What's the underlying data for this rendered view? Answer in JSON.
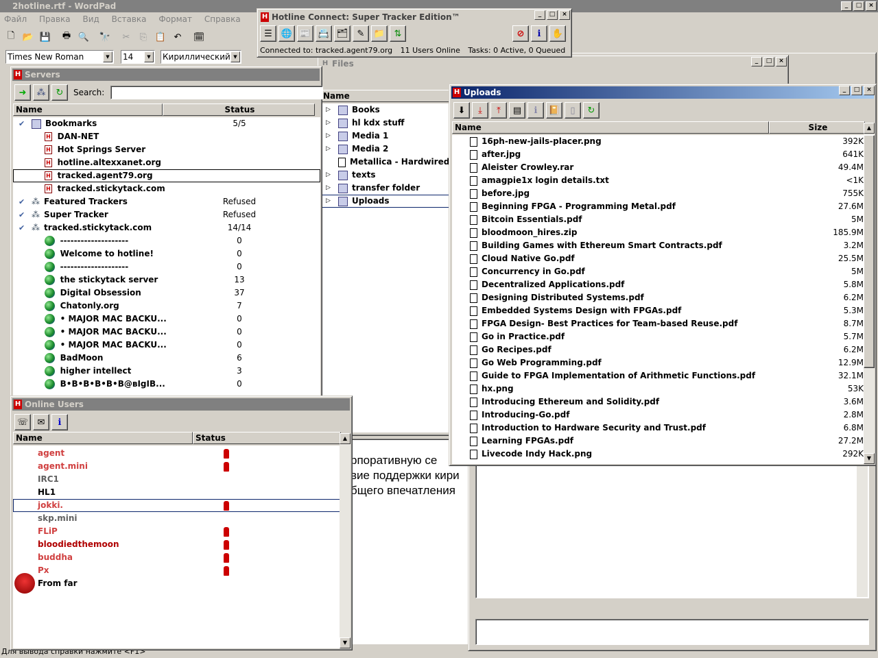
{
  "wordpad": {
    "title": "2hotline.rtf - WordPad",
    "menu": [
      "Файл",
      "Правка",
      "Вид",
      "Вставка",
      "Формат",
      "Справка"
    ],
    "font": "Times New Roman",
    "size": "14",
    "script": "Кириллический",
    "doc_lines": [
      "рпоративную се",
      "вие поддержки кири",
      "бщего впечатления"
    ],
    "status": "Для вывода справки нажмите <F1>"
  },
  "hotline": {
    "title": "Hotline Connect: Super Tracker Edition™",
    "status": {
      "connected": "Connected to: tracked.agent79.org",
      "users": "11 Users Online",
      "tasks": "Tasks: 0 Active, 0 Queued"
    }
  },
  "servers": {
    "title": "Servers",
    "search_label": "Search:",
    "col_name": "Name",
    "col_status": "Status",
    "rows": [
      {
        "name": "Bookmarks",
        "status": "5/5",
        "type": "group",
        "indent": 0
      },
      {
        "name": "DAN-NET",
        "status": "",
        "type": "bm",
        "indent": 1
      },
      {
        "name": "Hot Springs Server",
        "status": "",
        "type": "bm",
        "indent": 1
      },
      {
        "name": "hotline.altexxanet.org",
        "status": "",
        "type": "bm",
        "indent": 1
      },
      {
        "name": "tracked.agent79.org",
        "status": "",
        "type": "bm",
        "indent": 1
      },
      {
        "name": "tracked.stickytack.com",
        "status": "",
        "type": "bm",
        "indent": 1
      },
      {
        "name": "Featured Trackers",
        "status": "Refused",
        "type": "tracker",
        "indent": 0
      },
      {
        "name": "Super Tracker",
        "status": "Refused",
        "type": "tracker",
        "indent": 0
      },
      {
        "name": "tracked.stickytack.com",
        "status": "14/14",
        "type": "tracker",
        "indent": 0
      },
      {
        "name": "--------------------",
        "status": "0",
        "type": "globe",
        "indent": 1
      },
      {
        "name": "Welcome to hotline!",
        "status": "0",
        "type": "globe",
        "indent": 1
      },
      {
        "name": "--------------------",
        "status": "0",
        "type": "globe",
        "indent": 1
      },
      {
        "name": "the stickytack server",
        "status": "13",
        "type": "globe",
        "indent": 1
      },
      {
        "name": "Digital Obsession",
        "status": "37",
        "type": "globe",
        "indent": 1
      },
      {
        "name": "Chatonly.org",
        "status": "7",
        "type": "globe",
        "indent": 1
      },
      {
        "name": "• MAJOR MAC BACKU...",
        "status": "0",
        "type": "globe",
        "indent": 1
      },
      {
        "name": "• MAJOR MAC BACKU...",
        "status": "0",
        "type": "globe",
        "indent": 1
      },
      {
        "name": "• MAJOR MAC BACKU...",
        "status": "0",
        "type": "globe",
        "indent": 1
      },
      {
        "name": "BadMoon",
        "status": "6",
        "type": "globe",
        "indent": 1
      },
      {
        "name": "higher intellect",
        "status": "3",
        "type": "globe",
        "indent": 1
      },
      {
        "name": "B•B•B•B•B•B@вIgIB...",
        "status": "0",
        "type": "globe",
        "indent": 1
      }
    ]
  },
  "users": {
    "title": "Online Users",
    "col_name": "Name",
    "col_status": "Status",
    "rows": [
      {
        "name": "agent",
        "color": "#d04040",
        "icon": true
      },
      {
        "name": "agent.mini",
        "color": "#d04040",
        "icon": true
      },
      {
        "name": "IRC1",
        "color": "#606060",
        "icon": false
      },
      {
        "name": "HL1",
        "color": "#000000",
        "icon": false
      },
      {
        "name": "jokki.",
        "color": "#d04040",
        "icon": true
      },
      {
        "name": "skp.mini",
        "color": "#606060",
        "icon": false
      },
      {
        "name": "FLiP",
        "color": "#d04040",
        "icon": true
      },
      {
        "name": "bloodiedthemoon",
        "color": "#b00000",
        "icon": true
      },
      {
        "name": "buddha",
        "color": "#d04040",
        "icon": true
      },
      {
        "name": "Px",
        "color": "#d04040",
        "icon": true
      },
      {
        "name": "From far",
        "color": "#000000",
        "icon": false
      }
    ]
  },
  "files": {
    "title": "Files",
    "col_name": "Name",
    "items": [
      "Books",
      "hl kdx stuff",
      "Media 1",
      "Media 2",
      "Metallica - Hardwired...",
      "texts",
      "transfer folder",
      "Uploads"
    ]
  },
  "uploads": {
    "title": "Uploads",
    "col_name": "Name",
    "col_size": "Size",
    "files": [
      {
        "name": "16ph-new-jails-placer.png",
        "size": "392K"
      },
      {
        "name": "after.jpg",
        "size": "641K"
      },
      {
        "name": "Aleister Crowley.rar",
        "size": "49.4M"
      },
      {
        "name": "amagpie1x login details.txt",
        "size": "<1K"
      },
      {
        "name": "before.jpg",
        "size": "755K"
      },
      {
        "name": "Beginning FPGA - Programming Metal.pdf",
        "size": "27.6M"
      },
      {
        "name": "Bitcoin Essentials.pdf",
        "size": "5M"
      },
      {
        "name": "bloodmoon_hires.zip",
        "size": "185.9M"
      },
      {
        "name": "Building Games with Ethereum Smart Contracts.pdf",
        "size": "3.2M"
      },
      {
        "name": "Cloud Native Go.pdf",
        "size": "25.5M"
      },
      {
        "name": "Concurrency in Go.pdf",
        "size": "5M"
      },
      {
        "name": "Decentralized Applications.pdf",
        "size": "5.8M"
      },
      {
        "name": "Designing Distributed Systems.pdf",
        "size": "6.2M"
      },
      {
        "name": "Embedded Systems Design with FPGAs.pdf",
        "size": "5.3M"
      },
      {
        "name": "FPGA Design- Best Practices for Team-based Reuse.pdf",
        "size": "8.7M"
      },
      {
        "name": "Go in Practice.pdf",
        "size": "5.7M"
      },
      {
        "name": "Go Recipes.pdf",
        "size": "6.2M"
      },
      {
        "name": "Go Web Programming.pdf",
        "size": "12.9M"
      },
      {
        "name": "Guide to FPGA Implementation of Arithmetic Functions.pdf",
        "size": "32.1M"
      },
      {
        "name": "hx.png",
        "size": "53K"
      },
      {
        "name": "Introducing Ethereum and Solidity.pdf",
        "size": "3.6M"
      },
      {
        "name": "Introducing-Go.pdf",
        "size": "2.8M"
      },
      {
        "name": "Introduction to Hardware Security and Trust.pdf",
        "size": "6.8M"
      },
      {
        "name": "Learning FPGAs.pdf",
        "size": "27.2M"
      },
      {
        "name": "Livecode Indy Hack.png",
        "size": "292K"
      }
    ]
  }
}
